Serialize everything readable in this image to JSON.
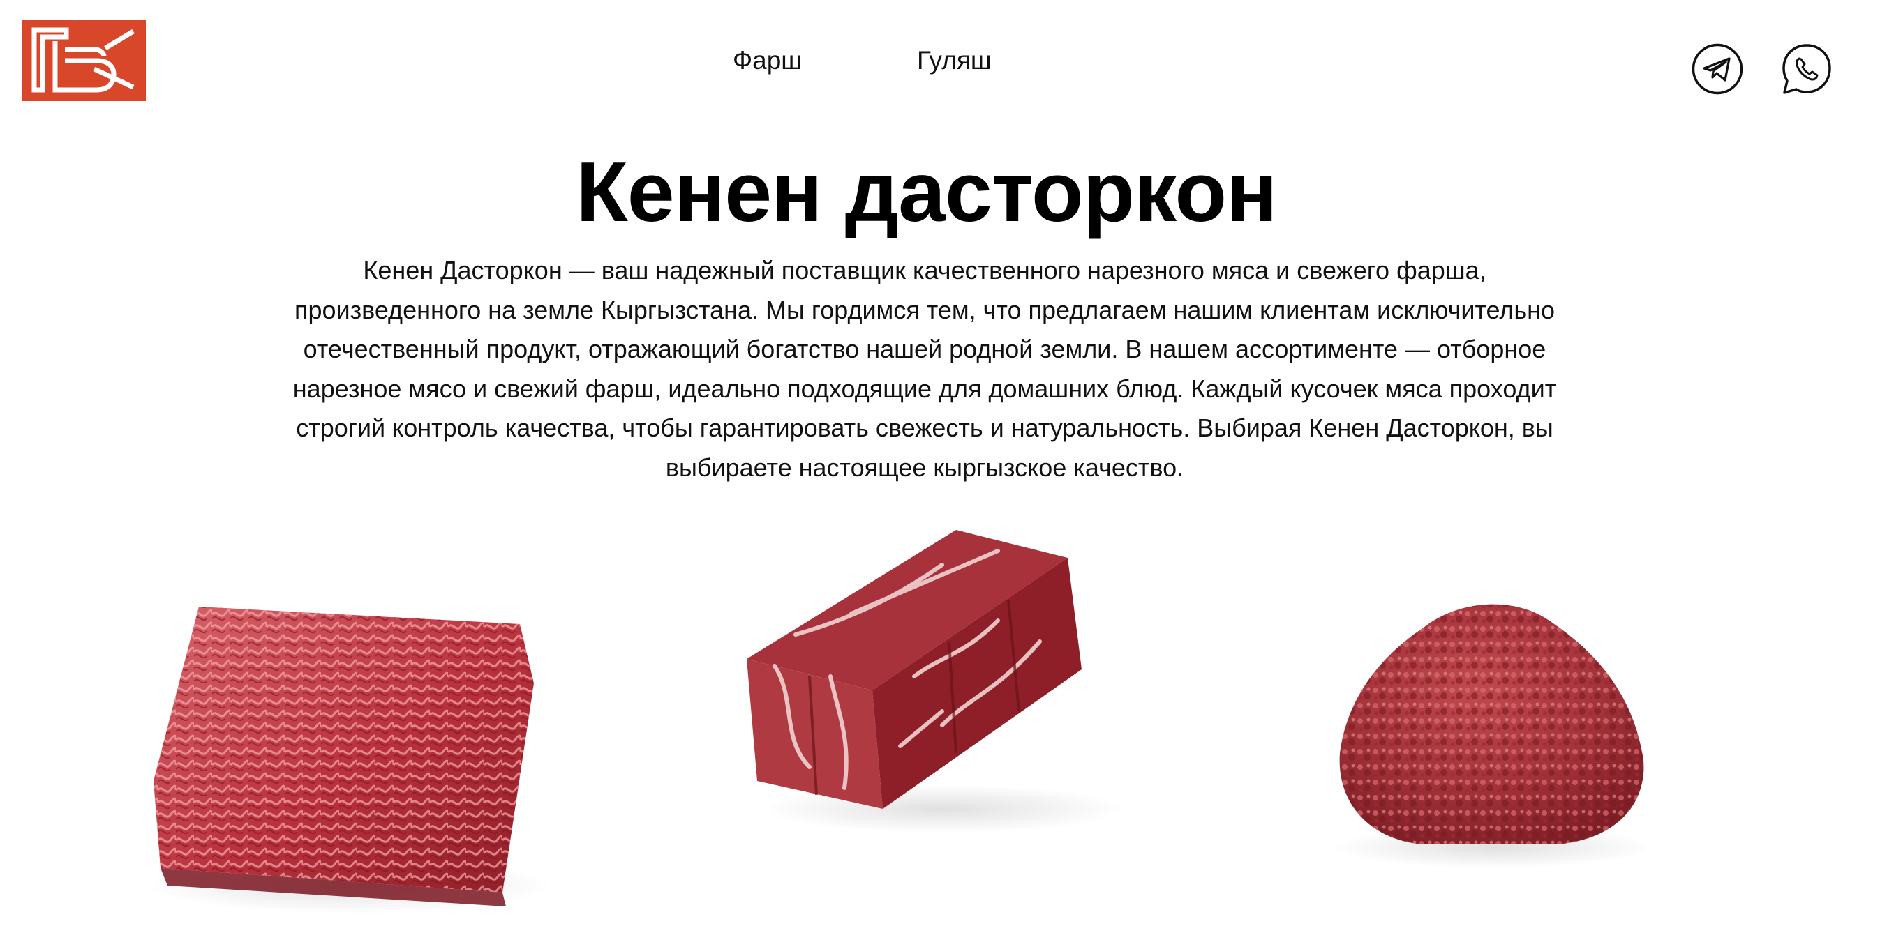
{
  "brand": {
    "logo_icon": "kd-logo-mark",
    "logo_color": "#D9472B"
  },
  "nav": {
    "items": [
      {
        "label": "Фарш"
      },
      {
        "label": "Гуляш"
      }
    ]
  },
  "social": {
    "telegram_icon": "telegram-icon",
    "whatsapp_icon": "whatsapp-icon"
  },
  "hero": {
    "title": "Кенен дасторкон",
    "description": "Кенен Дасторкон — ваш надежный поставщик качественного нарезного мяса и свежего фарша, произведенного на земле Кыргызстана. Мы гордимся тем, что предлагаем нашим клиентам исключительно отечественный продукт, отражающий богатство нашей родной земли. В нашем ассортименте — отборное нарезное мясо и свежий фарш, идеально подходящие для домашних блюд. Каждый кусочек мяса проходит строгий контроль качества, чтобы гарантировать свежесть и натуральность. Выбирая Кенен Дасторкон, вы выбираете настоящее кыргызское качество."
  },
  "products": [
    {
      "image": "ground-meat-block"
    },
    {
      "image": "beef-cubes"
    },
    {
      "image": "ground-meat-pile"
    }
  ],
  "colors": {
    "accent": "#D9472B",
    "meat_dark": "#8E1E28",
    "meat_mid": "#B8313C",
    "meat_light": "#D9646B",
    "fat": "#F1D3D3"
  }
}
